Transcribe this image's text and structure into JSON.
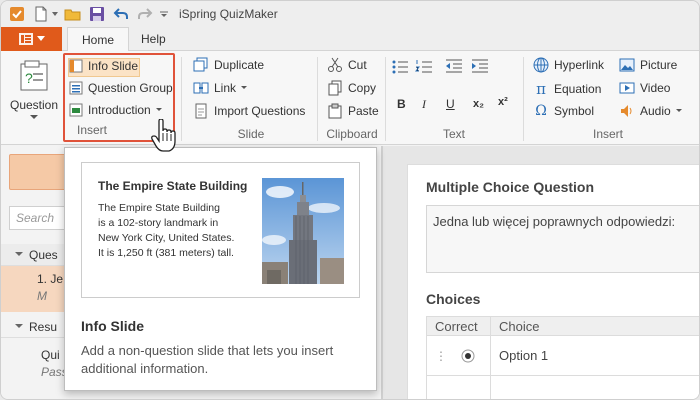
{
  "app": {
    "title": "iSpring QuizMaker"
  },
  "tabs": {
    "file_icon": "menu-icon",
    "home": "Home",
    "help": "Help"
  },
  "ribbon": {
    "question": {
      "label": "Question"
    },
    "insert": {
      "info_slide": "Info Slide",
      "question_group": "Question Group",
      "introduction": "Introduction",
      "group_label": "Insert"
    },
    "slide": {
      "duplicate": "Duplicate",
      "link": "Link",
      "import_questions": "Import Questions",
      "group_label": "Slide"
    },
    "clipboard": {
      "cut": "Cut",
      "copy": "Copy",
      "paste": "Paste",
      "group_label": "Clipboard"
    },
    "text": {
      "bold": "B",
      "italic": "I",
      "underline": "U",
      "subscript": "x₂",
      "superscript": "x²",
      "group_label": "Text"
    },
    "insert2": {
      "hyperlink": "Hyperlink",
      "equation": "Equation",
      "symbol": "Symbol",
      "picture": "Picture",
      "video": "Video",
      "audio": "Audio",
      "group_label": "Insert"
    }
  },
  "left": {
    "search_placeholder": "Search",
    "section1_label": "Ques",
    "item1_number": "1. Je",
    "item1_sub": "M",
    "section2_label": "Resu",
    "item2_label": "Qui",
    "item2_sub": "Pass"
  },
  "editor": {
    "question_type": "Multiple Choice Question",
    "question_text": "Jedna lub więcej poprawnych odpowiedzi:",
    "choices_label": "Choices",
    "col_correct": "Correct",
    "col_choice": "Choice",
    "option1": "Option 1"
  },
  "popup": {
    "preview_title": "The Empire State Building",
    "preview_body": [
      "The Empire State Building",
      "is a 102-story landmark in",
      "New York City, United States.",
      "It is 1,250 ft (381 meters) tall."
    ],
    "title": "Info Slide",
    "description": [
      "Add a non-question slide that lets you insert",
      "additional information."
    ]
  },
  "colors": {
    "accent": "#e05a1b",
    "highlight_border": "#e0533a",
    "hover_bg": "#fbe3c6"
  }
}
